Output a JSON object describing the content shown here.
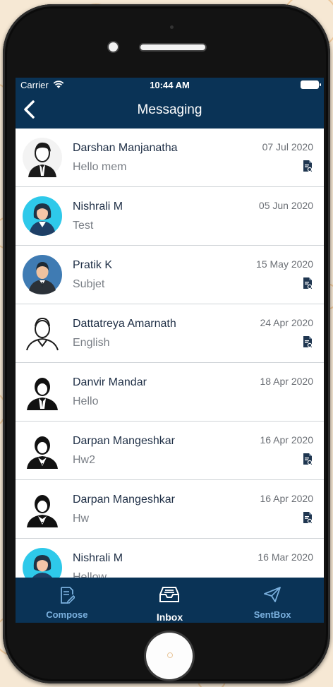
{
  "status_bar": {
    "carrier": "Carrier",
    "time": "10:44 AM"
  },
  "nav": {
    "title": "Messaging"
  },
  "messages": [
    {
      "name": "Darshan Manjanatha",
      "subject": "Hello mem",
      "date": "07 Jul 2020",
      "attachment": true,
      "avatar": "male-suit-avatar"
    },
    {
      "name": "Nishrali M",
      "subject": "Test",
      "date": "05 Jun 2020",
      "attachment": false,
      "avatar": "female-cyan-avatar"
    },
    {
      "name": "Pratik K",
      "subject": "Subjet",
      "date": "15 May 2020",
      "attachment": true,
      "avatar": "male-blue-avatar"
    },
    {
      "name": "Dattatreya Amarnath",
      "subject": "English",
      "date": "24 Apr 2020",
      "attachment": true,
      "avatar": "male-outline-avatar"
    },
    {
      "name": "Danvir Mandar",
      "subject": "Hello",
      "date": "18 Apr 2020",
      "attachment": false,
      "avatar": "male-black-avatar"
    },
    {
      "name": "Darpan Mangeshkar",
      "subject": "Hw2",
      "date": "16 Apr 2020",
      "attachment": true,
      "avatar": "male-black-avatar"
    },
    {
      "name": "Darpan Mangeshkar",
      "subject": "Hw",
      "date": "16 Apr 2020",
      "attachment": true,
      "avatar": "male-black-avatar"
    },
    {
      "name": "Nishrali M",
      "subject": "Hellow",
      "date": "16 Mar 2020",
      "attachment": false,
      "avatar": "female-cyan-avatar"
    }
  ],
  "tabs": [
    {
      "label": "Compose",
      "icon": "compose-icon",
      "active": false
    },
    {
      "label": "Inbox",
      "icon": "inbox-tray-icon",
      "active": true
    },
    {
      "label": "SentBox",
      "icon": "paper-plane-icon",
      "active": false
    }
  ],
  "colors": {
    "header": "#0a3356",
    "tab_active": "#ffffff",
    "tab_inactive": "#7ab0de",
    "background": "#f6e8d4"
  }
}
